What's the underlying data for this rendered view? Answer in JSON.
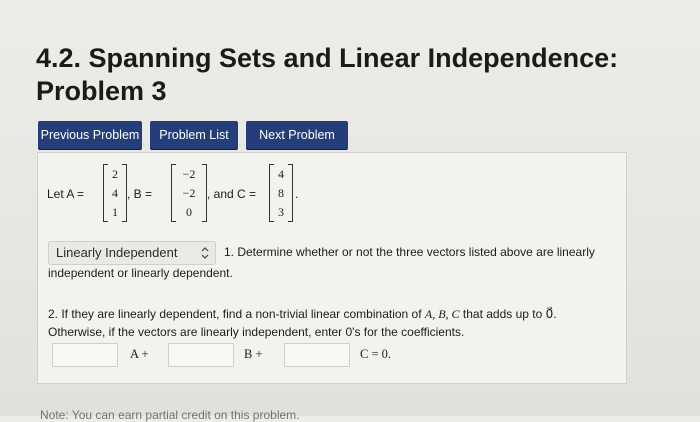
{
  "title": {
    "line1": "4.2. Spanning Sets and Linear Independence:",
    "line2": "Problem 3"
  },
  "nav": {
    "previous": "Previous Problem",
    "list": "Problem List",
    "next": "Next Problem"
  },
  "vectors": {
    "let_label": "Let A =",
    "A": [
      "2",
      "4",
      "1"
    ],
    "b_label": ", B =",
    "B": [
      "−2",
      "−2",
      "0"
    ],
    "c_label": ", and C =",
    "C": [
      "4",
      "8",
      "3"
    ],
    "end": "."
  },
  "q1": {
    "select_value": "Linearly Independent",
    "text_line1": "1. Determine whether or not the three vectors listed above are linearly",
    "text_line2": "independent or linearly dependent."
  },
  "q2": {
    "line1_pre": "2. If they are linearly dependent, find a non-trivial linear combination of ",
    "vars": "A, B, C",
    "line1_post": " that adds up to ",
    "zero": "0⃗.",
    "line2": "Otherwise, if the vectors are linearly independent, enter 0's for the coefficients.",
    "a_label": "A +",
    "b_label": "B +",
    "c_label": "C = 0."
  },
  "footer": "Note: You can earn partial credit on this problem."
}
